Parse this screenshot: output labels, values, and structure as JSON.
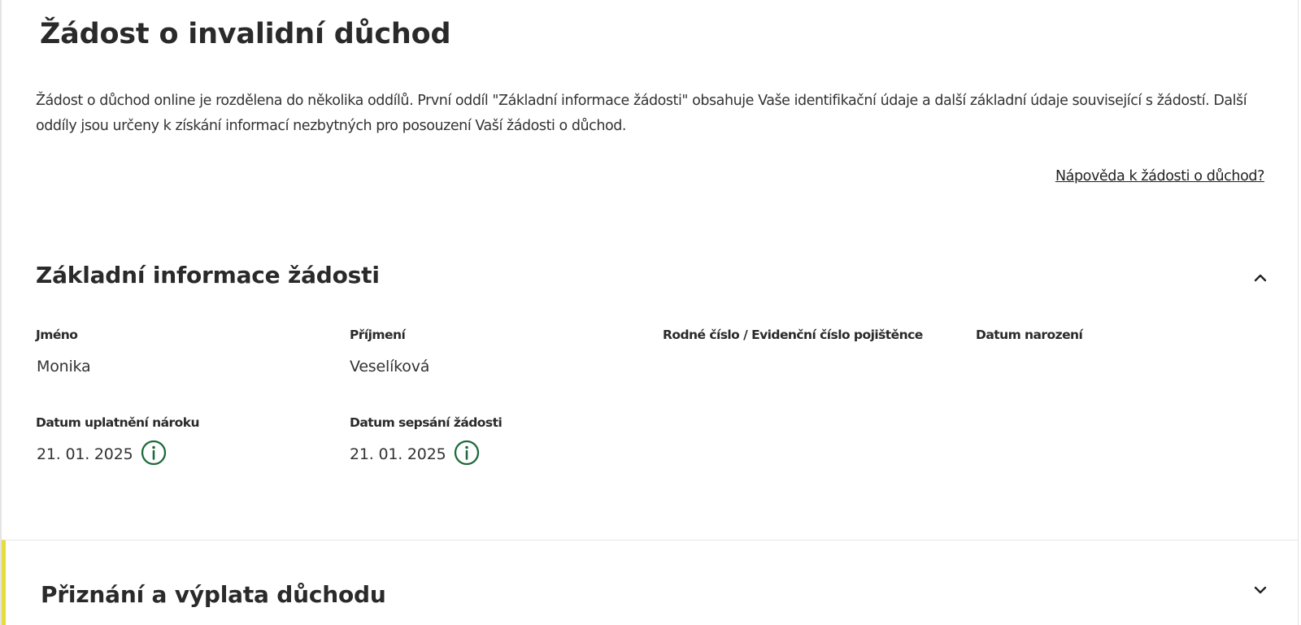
{
  "page": {
    "title": "Žádost o invalidní důchod",
    "intro": "Žádost o důchod online je rozdělena do několika oddílů. První oddíl \"Základní informace žádosti\" obsahuje Vaše identifikační údaje a další základní údaje související s žádostí. Další oddíly jsou určeny k získání informací nezbytných pro posouzení Vaší žádosti o důchod.",
    "help_link": "Nápověda k žádosti o důchod?"
  },
  "sections": {
    "basic_info": {
      "title": "Základní informace žádosti",
      "expanded": true,
      "chevron_icon": "chevron-up-icon",
      "fields": {
        "first_name": {
          "label": "Jméno",
          "value": "Monika"
        },
        "last_name": {
          "label": "Příjmení",
          "value": "Veselíková"
        },
        "birth_number": {
          "label": "Rodné číslo / Evidenční číslo pojištěnce",
          "value": ""
        },
        "birth_date": {
          "label": "Datum narození",
          "value": ""
        },
        "claim_date": {
          "label": "Datum uplatnění nároku",
          "value": "21. 01. 2025",
          "icon": "info-icon"
        },
        "filing_date": {
          "label": "Datum sepsání žádosti",
          "value": "21. 01. 2025",
          "icon": "info-icon"
        }
      }
    },
    "award_payment": {
      "title": "Přiznání a výplata důchodu",
      "expanded": false,
      "chevron_icon": "chevron-down-icon"
    }
  },
  "colors": {
    "accent_green": "#1f6b3a",
    "active_section_bar": "#e6dc3c",
    "text": "#2a2a2a"
  }
}
